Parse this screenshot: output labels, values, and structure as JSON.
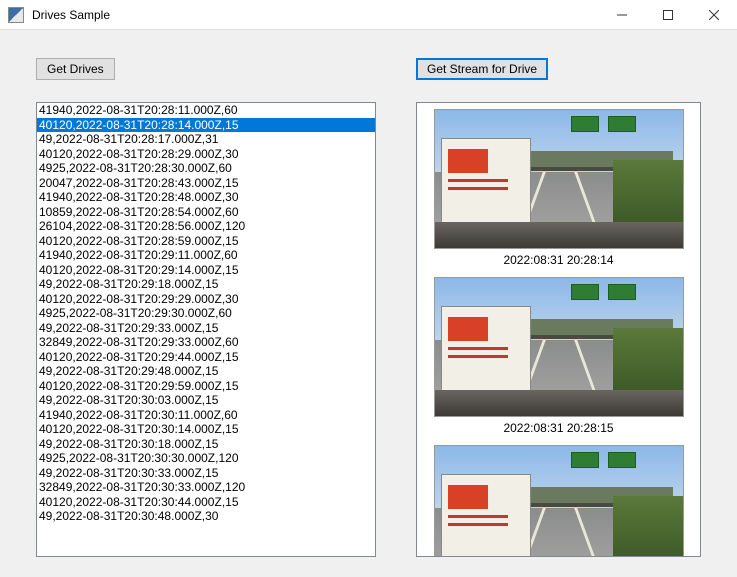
{
  "window": {
    "title": "Drives Sample"
  },
  "buttons": {
    "get_drives": "Get Drives",
    "get_stream": "Get Stream for Drive"
  },
  "drives": {
    "selected_index": 1,
    "items": [
      "41940,2022-08-31T20:28:11.000Z,60",
      "40120,2022-08-31T20:28:14.000Z,15",
      "49,2022-08-31T20:28:17.000Z,31",
      "40120,2022-08-31T20:28:29.000Z,30",
      "4925,2022-08-31T20:28:30.000Z,60",
      "20047,2022-08-31T20:28:43.000Z,15",
      "41940,2022-08-31T20:28:48.000Z,30",
      "10859,2022-08-31T20:28:54.000Z,60",
      "26104,2022-08-31T20:28:56.000Z,120",
      "40120,2022-08-31T20:28:59.000Z,15",
      "41940,2022-08-31T20:29:11.000Z,60",
      "40120,2022-08-31T20:29:14.000Z,15",
      "49,2022-08-31T20:29:18.000Z,15",
      "40120,2022-08-31T20:29:29.000Z,30",
      "4925,2022-08-31T20:29:30.000Z,60",
      "49,2022-08-31T20:29:33.000Z,15",
      "32849,2022-08-31T20:29:33.000Z,60",
      "40120,2022-08-31T20:29:44.000Z,15",
      "49,2022-08-31T20:29:48.000Z,15",
      "40120,2022-08-31T20:29:59.000Z,15",
      "49,2022-08-31T20:30:03.000Z,15",
      "41940,2022-08-31T20:30:11.000Z,60",
      "40120,2022-08-31T20:30:14.000Z,15",
      "49,2022-08-31T20:30:18.000Z,15",
      "4925,2022-08-31T20:30:30.000Z,120",
      "49,2022-08-31T20:30:33.000Z,15",
      "32849,2022-08-31T20:30:33.000Z,120",
      "40120,2022-08-31T20:30:44.000Z,15",
      "49,2022-08-31T20:30:48.000Z,30"
    ]
  },
  "stream": {
    "frames": [
      {
        "caption": "2022:08:31 20:28:14"
      },
      {
        "caption": "2022:08:31 20:28:15"
      },
      {
        "caption": ""
      }
    ]
  }
}
